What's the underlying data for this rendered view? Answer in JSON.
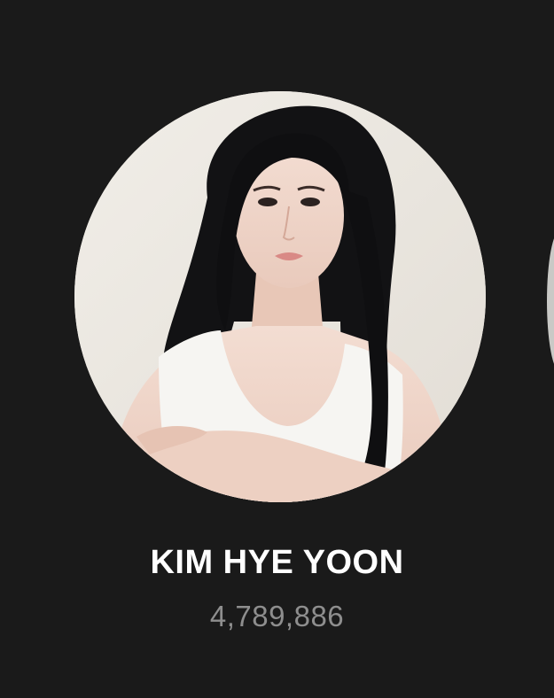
{
  "profile": {
    "name": "KIM HYE YOON",
    "count": "4,789,886"
  },
  "colors": {
    "background": "#1a1a1a",
    "name_text": "#ffffff",
    "count_text": "#8e8e8e"
  },
  "icons": {
    "avatar": "profile-photo"
  }
}
